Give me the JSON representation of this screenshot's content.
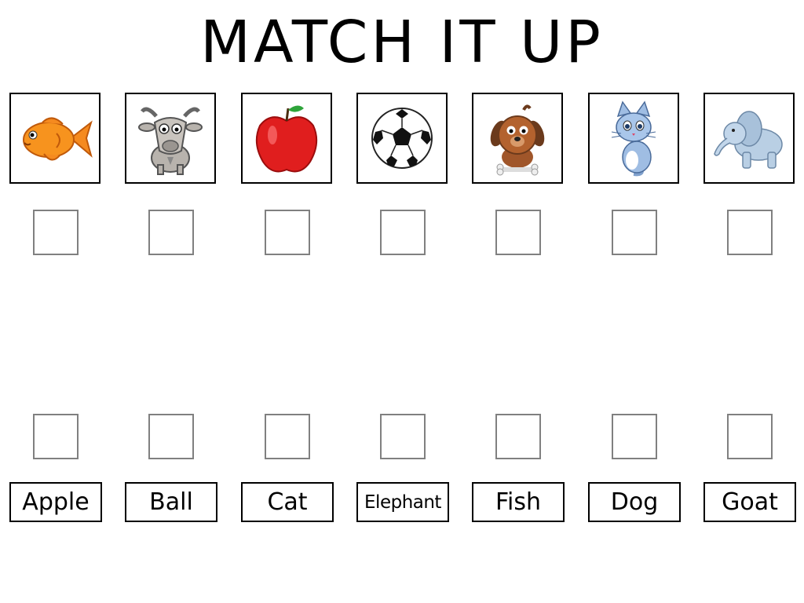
{
  "title": "MATCH IT UP",
  "pictures": [
    {
      "icon": "fish-icon"
    },
    {
      "icon": "goat-icon"
    },
    {
      "icon": "apple-icon"
    },
    {
      "icon": "ball-icon"
    },
    {
      "icon": "dog-icon"
    },
    {
      "icon": "cat-icon"
    },
    {
      "icon": "elephant-icon"
    }
  ],
  "words": [
    "Apple",
    "Ball",
    "Cat",
    "Elephant",
    "Fish",
    "Dog",
    "Goat"
  ],
  "colors": {
    "frame": "#000000",
    "slot_border": "#808080"
  }
}
